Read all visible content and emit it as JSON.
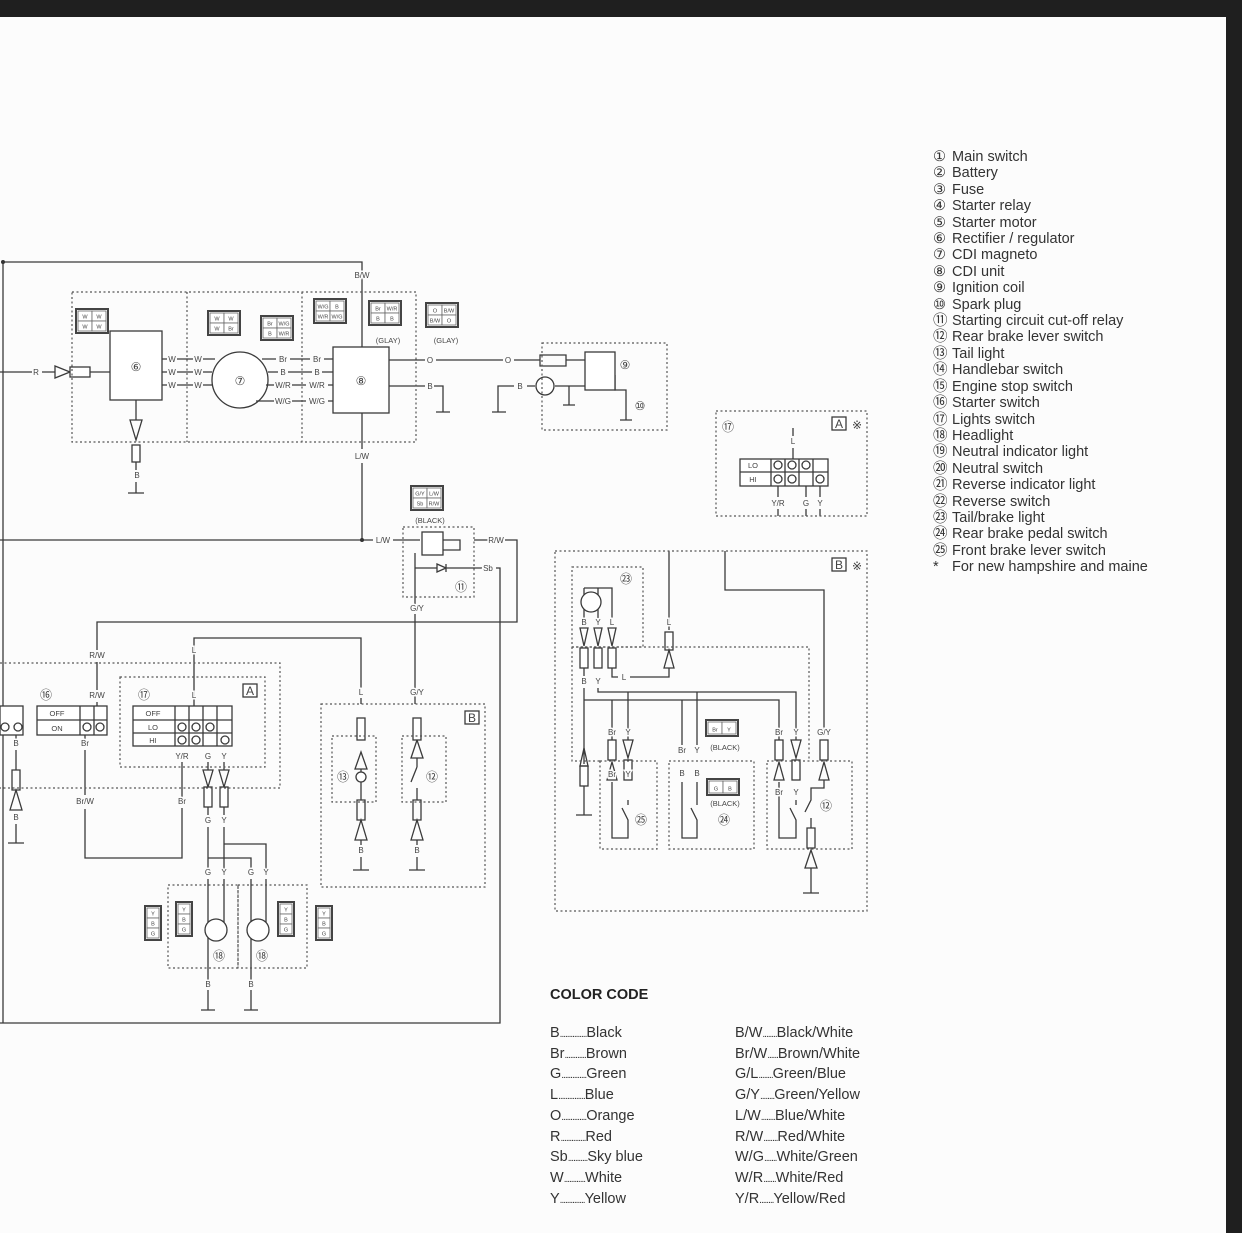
{
  "legend": {
    "items": [
      {
        "num": "①",
        "label": "Main switch"
      },
      {
        "num": "②",
        "label": "Battery"
      },
      {
        "num": "③",
        "label": "Fuse"
      },
      {
        "num": "④",
        "label": "Starter relay"
      },
      {
        "num": "⑤",
        "label": "Starter motor"
      },
      {
        "num": "⑥",
        "label": "Rectifier / regulator"
      },
      {
        "num": "⑦",
        "label": "CDI magneto"
      },
      {
        "num": "⑧",
        "label": "CDI unit"
      },
      {
        "num": "⑨",
        "label": "Ignition coil"
      },
      {
        "num": "⑩",
        "label": "Spark plug"
      },
      {
        "num": "⑪",
        "label": "Starting circuit cut-off relay"
      },
      {
        "num": "⑫",
        "label": "Rear brake lever switch"
      },
      {
        "num": "⑬",
        "label": "Tail light"
      },
      {
        "num": "⑭",
        "label": "Handlebar switch"
      },
      {
        "num": "⑮",
        "label": "Engine stop switch"
      },
      {
        "num": "⑯",
        "label": "Starter switch"
      },
      {
        "num": "⑰",
        "label": "Lights switch"
      },
      {
        "num": "⑱",
        "label": "Headlight"
      },
      {
        "num": "⑲",
        "label": "Neutral indicator light"
      },
      {
        "num": "⑳",
        "label": "Neutral switch"
      },
      {
        "num": "㉑",
        "label": "Reverse indicator light"
      },
      {
        "num": "㉒",
        "label": "Reverse switch"
      },
      {
        "num": "㉓",
        "label": "Tail/brake light"
      },
      {
        "num": "㉔",
        "label": "Rear brake pedal switch"
      },
      {
        "num": "㉕",
        "label": "Front brake lever switch"
      },
      {
        "num": "*",
        "label": "For new hampshire and maine"
      }
    ]
  },
  "color_code": {
    "title": "COLOR CODE",
    "left": [
      {
        "code": "B",
        "dots": "...............",
        "name": "Black"
      },
      {
        "code": "Br",
        "dots": "............",
        "name": "Brown"
      },
      {
        "code": "G",
        "dots": "..............",
        "name": "Green"
      },
      {
        "code": "L",
        "dots": "...............",
        "name": "Blue"
      },
      {
        "code": "O",
        "dots": "..............",
        "name": "Orange"
      },
      {
        "code": "R",
        "dots": "..............",
        "name": "Red"
      },
      {
        "code": "Sb",
        "dots": "...........",
        "name": "Sky blue"
      },
      {
        "code": "W",
        "dots": "............",
        "name": "White"
      },
      {
        "code": "Y",
        "dots": "..............",
        "name": "Yellow"
      }
    ],
    "right": [
      {
        "code": "B/W",
        "dots": "........",
        "name": "Black/White"
      },
      {
        "code": "Br/W",
        "dots": "......",
        "name": "Brown/White"
      },
      {
        "code": "G/L",
        "dots": "........",
        "name": "Green/Blue"
      },
      {
        "code": "G/Y",
        "dots": "........",
        "name": "Green/Yellow"
      },
      {
        "code": "L/W",
        "dots": "........",
        "name": "Blue/White"
      },
      {
        "code": "R/W",
        "dots": "........",
        "name": "Red/White"
      },
      {
        "code": "W/G",
        "dots": ".......",
        "name": "White/Green"
      },
      {
        "code": "W/R",
        "dots": ".......",
        "name": "White/Red"
      },
      {
        "code": "Y/R",
        "dots": "........",
        "name": "Yellow/Red"
      }
    ]
  },
  "diagram": {
    "wire_labels": [
      "B/W",
      "R",
      "W",
      "W",
      "W",
      "W",
      "W",
      "W",
      "Br",
      "B",
      "W/R",
      "W/G",
      "Br",
      "B",
      "W/R",
      "W/G",
      "B",
      "O",
      "B",
      "O",
      "B",
      "L/W",
      "L/W",
      "R/W",
      "Sb",
      "G/Y",
      "R/W",
      "R/W",
      "Br",
      "Br/W",
      "Y/R",
      "G",
      "Y",
      "Br",
      "G",
      "Y",
      "G",
      "Y",
      "G",
      "Y",
      "B",
      "B",
      "L",
      "L",
      "L",
      "G/Y",
      "B",
      "B",
      "B",
      "B",
      "L",
      "Y/R",
      "G",
      "Y",
      "B",
      "Y",
      "L",
      "L",
      "B",
      "Y",
      "L",
      "Br",
      "Y",
      "Br",
      "Y",
      "Br",
      "Y",
      "B",
      "B",
      "Br",
      "Y",
      "G/Y",
      "Br",
      "Y"
    ],
    "components": [
      "⑥",
      "⑦",
      "⑧",
      "⑨",
      "⑩",
      "⑪",
      "⑯",
      "⑰",
      "⑬",
      "⑫",
      "⑱",
      "⑱",
      "⑰",
      "㉓",
      "㉕",
      "㉔",
      "⑫"
    ],
    "section_tags": [
      "A",
      "B",
      "A",
      "B"
    ],
    "asterisk_mark": "※",
    "connector_captions": [
      "(GLAY)",
      "(GLAY)",
      "(BLACK)",
      "(BLACK)",
      "(BLACK)"
    ],
    "connector_pins": [
      "W",
      "W",
      "W",
      "W",
      "W",
      "W",
      "Br",
      "W/G",
      "B",
      "W/R",
      "W/G",
      "Br",
      "W/R",
      "B",
      "B",
      "O",
      "B/W",
      "B/W",
      "O",
      "B",
      "B/W",
      "L/W",
      "G/Y",
      "L/W",
      "Sb",
      "R/W",
      "Br",
      "Y",
      "G",
      "B",
      "Y",
      "B",
      "G",
      "Y",
      "B",
      "G",
      "Y",
      "B",
      "G",
      "Y",
      "B",
      "G"
    ],
    "switch_labels": {
      "starter_off": "OFF",
      "starter_on": "ON",
      "lights_off": "OFF",
      "lights_lo": "LO",
      "lights_hi": "HI",
      "alt_lo": "LO",
      "alt_hi": "HI"
    }
  }
}
